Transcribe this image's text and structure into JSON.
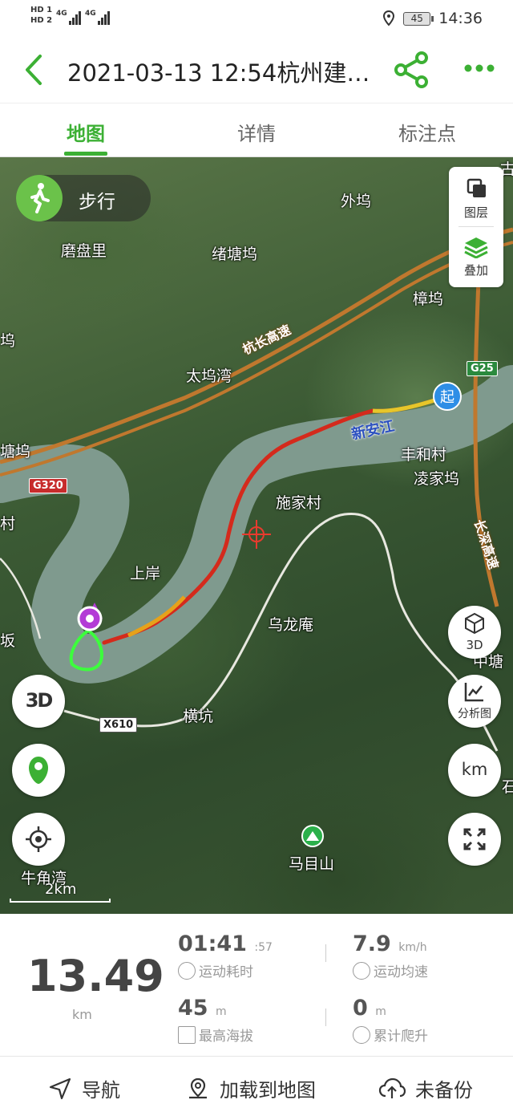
{
  "status_bar": {
    "hd1": "HD 1",
    "hd2": "HD 2",
    "net1": "4G",
    "net2": "4G",
    "battery": "45",
    "time": "14:36"
  },
  "header": {
    "title": "2021-03-13 12:54杭州建…",
    "share_icon": "share-icon",
    "more_icon": "more-icon",
    "accent": "#3cb034"
  },
  "tabs": [
    {
      "label": "地图",
      "active": true
    },
    {
      "label": "详情",
      "active": false
    },
    {
      "label": "标注点",
      "active": false
    }
  ],
  "map": {
    "mode_label": "步行",
    "layers": {
      "layer_label": "图层",
      "overlay_label": "叠加"
    },
    "buttons": {
      "three_d_label": "3D",
      "analysis_label": "分析图",
      "unit_label": "km"
    },
    "scale_label": "2km",
    "start_marker": "起",
    "places": [
      "外坞",
      "磨盘里",
      "绪塘坞",
      "樟坞",
      "坞",
      "太坞湾",
      "塘坞",
      "丰和村",
      "凌家坞",
      "施家村",
      "村",
      "上岸",
      "乌龙庵",
      "坂",
      "中塘",
      "横坑",
      "石",
      "马目山",
      "牛角湾",
      "古"
    ],
    "roads": [
      "杭长高速",
      "长深高速"
    ],
    "river": "新安江",
    "shields": [
      "G320",
      "G25",
      "X610"
    ]
  },
  "stats": {
    "distance": "13.49",
    "distance_unit": "km",
    "duration": "01:41",
    "duration_sec": ":57",
    "duration_label": "运动耗时",
    "speed": "7.9",
    "speed_unit": "km/h",
    "speed_label": "运动均速",
    "altitude": "45",
    "altitude_unit": "m",
    "altitude_label": "最高海拔",
    "climb": "0",
    "climb_unit": "m",
    "climb_label": "累计爬升"
  },
  "bottom_bar": {
    "navigate": "导航",
    "load_to_map": "加载到地图",
    "backup": "未备份"
  }
}
